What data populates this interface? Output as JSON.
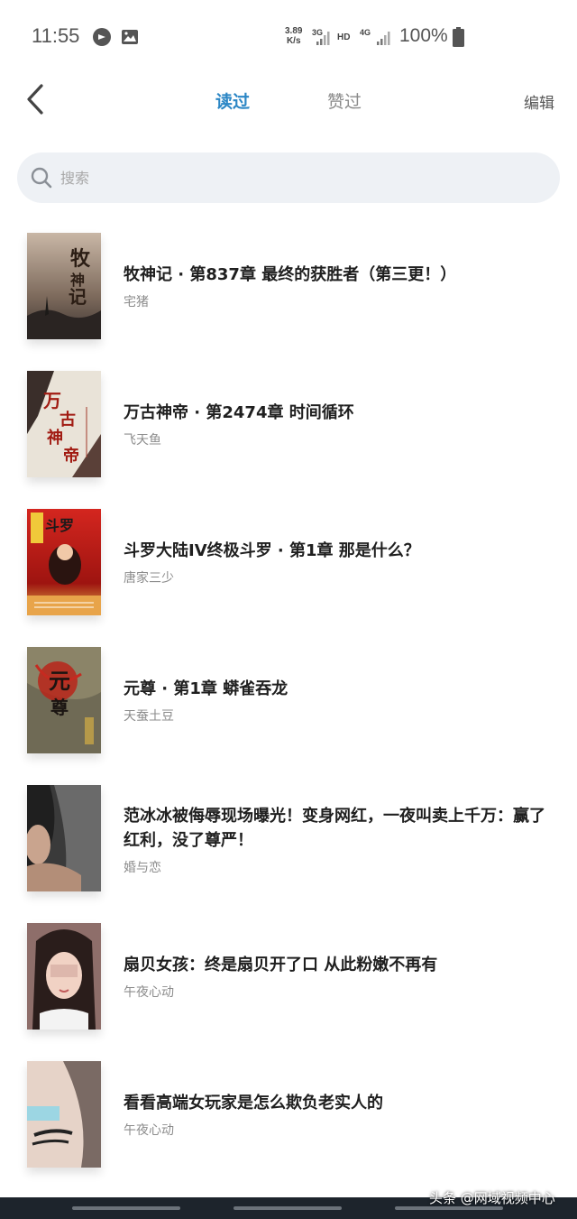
{
  "status_bar": {
    "time": "11:55",
    "net_speed_value": "3.89",
    "net_speed_unit": "K/s",
    "net_3g": "3G",
    "hd": "HD",
    "net_4g": "4G",
    "battery": "100%"
  },
  "header": {
    "tab_read": "读过",
    "tab_liked": "赞过",
    "edit": "编辑",
    "active_color": "#2b86c5"
  },
  "search": {
    "placeholder": "搜索"
  },
  "items": [
    {
      "title": "牧神记 · 第837章 最终的获胜者（第三更！）",
      "author": "宅猪",
      "cover_text": "牧神记"
    },
    {
      "title": "万古神帝 · 第2474章 时间循环",
      "author": "飞天鱼",
      "cover_text": "万古神帝"
    },
    {
      "title": "斗罗大陆IV终极斗罗 · 第1章 那是什么？",
      "author": "唐家三少",
      "cover_text": "斗罗大陆"
    },
    {
      "title": "元尊 · 第1章 蟒雀吞龙",
      "author": "天蚕土豆",
      "cover_text": "元尊"
    },
    {
      "title": "范冰冰被侮辱现场曝光！变身网红，一夜叫卖上千万：赢了红利，没了尊严！",
      "author": "婚与恋"
    },
    {
      "title": "扇贝女孩：终是扇贝开了口 从此粉嫩不再有",
      "author": "午夜心动"
    },
    {
      "title": "看看高端女玩家是怎么欺负老实人的",
      "author": "午夜心动"
    }
  ],
  "watermark": "头条 @网域视频中心"
}
